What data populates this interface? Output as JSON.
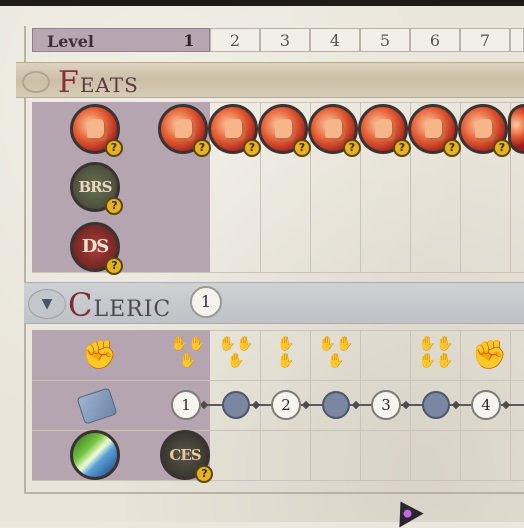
{
  "level_header": {
    "label": "Level",
    "levels": [
      "1",
      "2",
      "3",
      "4",
      "5",
      "6",
      "7"
    ],
    "current_level": "1"
  },
  "feats_section": {
    "title_initial": "F",
    "title_rest": "EATS",
    "rows": [
      {
        "icon": "fist-feat-icon",
        "unlocked_at_level": "1"
      },
      {
        "icon": "brs-feat-icon",
        "text": "BRS"
      },
      {
        "icon": "ds-feat-icon",
        "text": "DS"
      }
    ],
    "help_glyph": "?"
  },
  "cleric_section": {
    "title_initial": "C",
    "title_rest": "LERIC",
    "class_level": "1",
    "collapse_glyph": "▼"
  },
  "spell_track": {
    "levels": [
      "1",
      "2",
      "3",
      "4"
    ]
  },
  "domain_row": {
    "feat_text": "CES"
  },
  "colors": {
    "selected_column": "#b8a6b3",
    "feats_banner": "#cdbfa6",
    "cleric_banner": "#bfc2c6",
    "title_accent": "#8a2f3a",
    "spell_slot": "#7b86a2"
  }
}
